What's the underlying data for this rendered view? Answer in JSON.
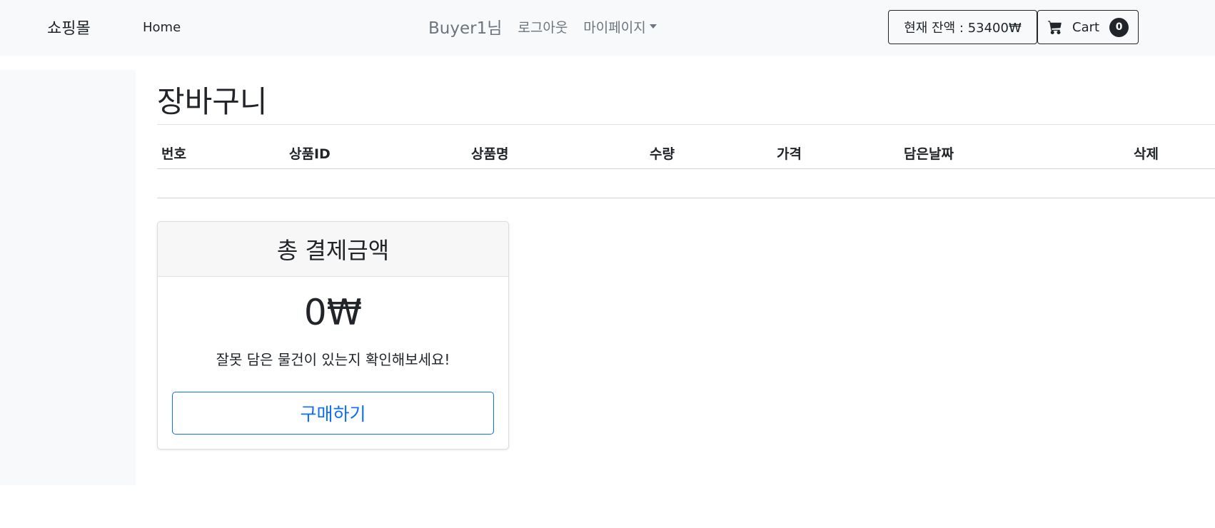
{
  "navbar": {
    "brand": "쇼핑몰",
    "home_label": "Home",
    "user_label": "Buyer1님",
    "logout_label": "로그아웃",
    "mypage_label": "마이페이지",
    "balance_label": "현재 잔액 : 53400₩",
    "cart_label": "Cart",
    "cart_count": "0"
  },
  "main": {
    "title": "장바구니",
    "table_headers": [
      "번호",
      "상품ID",
      "상품명",
      "수량",
      "가격",
      "담은날짜",
      "삭제"
    ]
  },
  "summary": {
    "header": "총 결제금액",
    "amount": "0₩",
    "hint": "잘못 담은 물건이 있는지 확인해보세요!",
    "buy_label": "구매하기"
  },
  "colors": {
    "navbar_bg": "#f8f9fa",
    "primary": "#0d6efd",
    "dark": "#212529",
    "muted": "#6c757d"
  },
  "icons": {
    "cart": "cart-icon",
    "dropdown": "caret-down-icon"
  }
}
